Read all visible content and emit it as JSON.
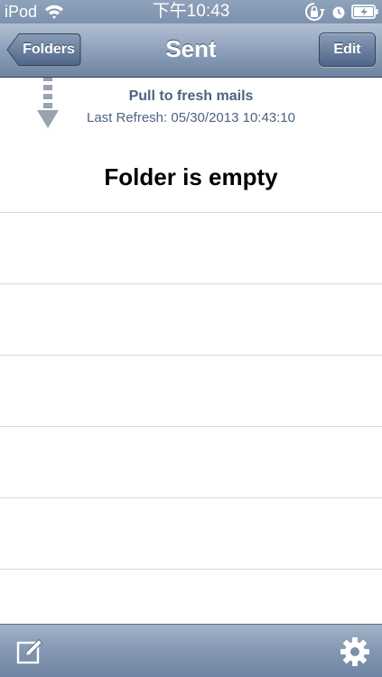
{
  "status_bar": {
    "carrier": "iPod",
    "time": "下午10:43",
    "icons": [
      "wifi-icon",
      "orientation-lock-icon",
      "alarm-icon",
      "battery-icon"
    ]
  },
  "nav_bar": {
    "back_label": "Folders",
    "title": "Sent",
    "edit_label": "Edit"
  },
  "refresh": {
    "pull_label": "Pull to fresh mails",
    "last_refresh": "Last Refresh: 05/30/2013 10:43:10"
  },
  "content": {
    "empty_message": "Folder is empty"
  },
  "toolbar": {
    "icons": [
      "compose-icon",
      "gear-icon"
    ]
  },
  "colors": {
    "nav_bar": "#8ea0b9",
    "refresh_text": "#4f6282",
    "divider": "#d9d9d9"
  }
}
